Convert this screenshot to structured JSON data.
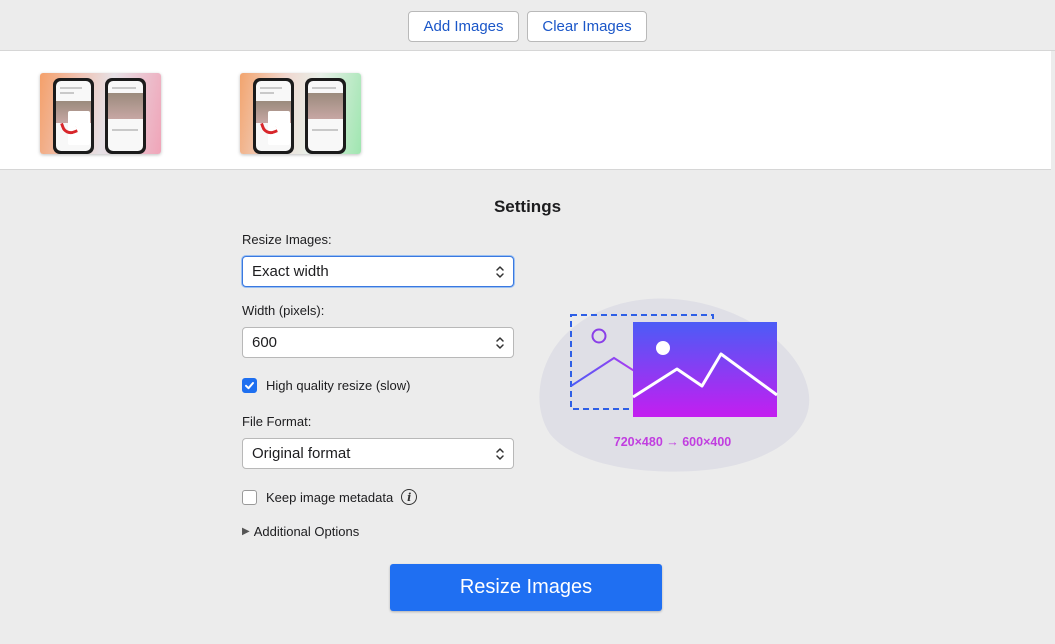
{
  "toolbar": {
    "add_label": "Add Images",
    "clear_label": "Clear Images"
  },
  "settings": {
    "title": "Settings",
    "resize_label": "Resize Images:",
    "resize_value": "Exact width",
    "width_label": "Width (pixels):",
    "width_value": "600",
    "hq_label": "High quality resize (slow)",
    "hq_checked": true,
    "format_label": "File Format:",
    "format_value": "Original format",
    "metadata_label": "Keep image metadata",
    "metadata_checked": false,
    "additional_label": "Additional Options",
    "resize_button": "Resize Images"
  },
  "illustration": {
    "dimensions_text": "720×480 → 600×400"
  },
  "colors": {
    "accent": "#1f6ff2",
    "link": "#1a56c8",
    "illustration_gradient_start": "#4b5cf6",
    "illustration_gradient_end": "#c41ef0",
    "dimensions_text": "#c13ee0"
  },
  "icons": {
    "select_chevron": "chevron-up-down-icon",
    "info": "info-icon",
    "disclosure": "triangle-right-icon"
  }
}
